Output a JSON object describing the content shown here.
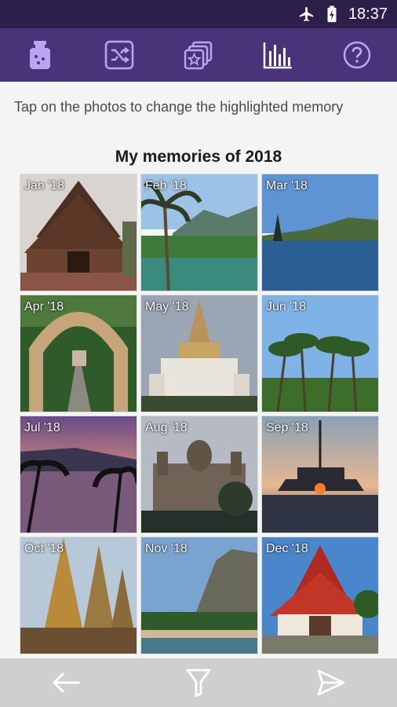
{
  "status_bar": {
    "time": "18:37",
    "icons": [
      "airplane-mode-icon",
      "battery-charging-icon"
    ]
  },
  "toolbar": {
    "items": [
      {
        "icon": "memory-jar-icon"
      },
      {
        "icon": "shuffle-icon"
      },
      {
        "icon": "photo-stack-star-icon"
      },
      {
        "icon": "bar-chart-icon"
      },
      {
        "icon": "help-icon"
      }
    ],
    "accent_color": "#b9a6f0"
  },
  "hint": "Tap on the photos to change the highlighted memory",
  "grid_title": "My memories of 2018",
  "months": [
    {
      "label": "Jan '18"
    },
    {
      "label": "Feb '18"
    },
    {
      "label": "Mar '18"
    },
    {
      "label": "Apr '18"
    },
    {
      "label": "May '18"
    },
    {
      "label": "Jun '18"
    },
    {
      "label": "Jul '18"
    },
    {
      "label": "Aug '18"
    },
    {
      "label": "Sep '18"
    },
    {
      "label": "Oct '18"
    },
    {
      "label": "Nov '18"
    },
    {
      "label": "Dec '18"
    }
  ],
  "bottom_nav": {
    "icons": [
      "back-arrow-icon",
      "filter-icon",
      "send-icon"
    ]
  },
  "colors": {
    "status_bar": "#2c1f4a",
    "toolbar": "#4a3379",
    "bottom_bar": "#cfcfcf"
  }
}
